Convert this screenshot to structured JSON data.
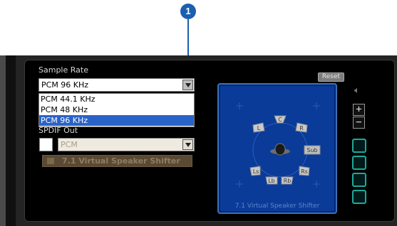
{
  "callout": {
    "number": "1"
  },
  "panel": {
    "sample_rate": {
      "label": "Sample Rate",
      "selected": "PCM 96 KHz",
      "options": [
        "PCM 44.1 KHz",
        "PCM 48 KHz",
        "PCM 96 KHz"
      ]
    },
    "spdif": {
      "label": "SPDIF Out",
      "selected": "PCM"
    },
    "virtual_shifter_button": "7.1 Virtual Speaker Shifter",
    "reset_label": "Reset",
    "viz": {
      "caption": "7.1 Virtual Speaker Shifter",
      "speakers": [
        "C",
        "L",
        "R",
        "Sub",
        "Ls",
        "Rs",
        "Lb",
        "Rb"
      ]
    }
  },
  "colors": {
    "accent": "#1c5fb0",
    "highlight": "#2a63c8",
    "teal": "#1fa89a"
  }
}
